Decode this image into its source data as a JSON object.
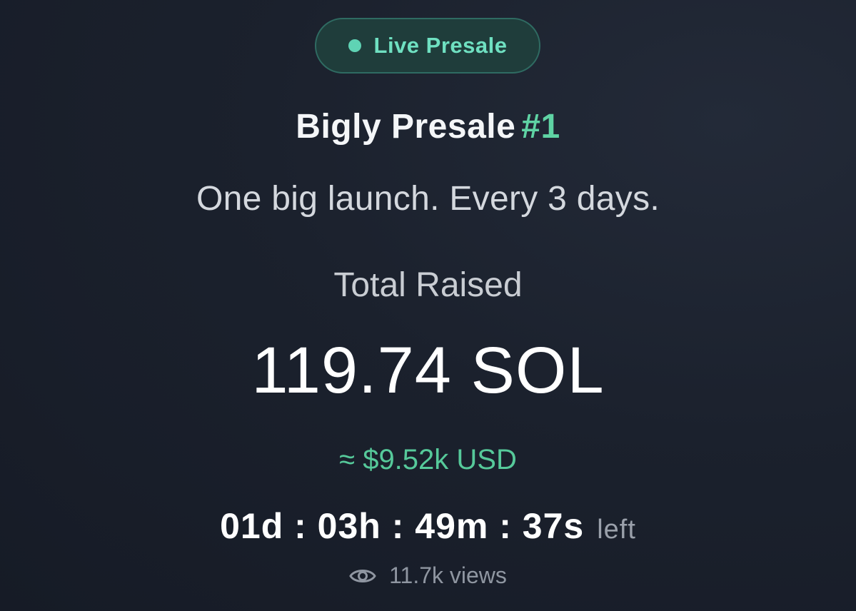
{
  "badge": {
    "label": "Live Presale",
    "dot_color": "#5fd3b4"
  },
  "presale": {
    "title": "Bigly Presale",
    "number": "#1",
    "tagline": "One big launch. Every 3 days."
  },
  "raised": {
    "label": "Total Raised",
    "value": "119.74 SOL",
    "usd": "≈ $9.52k USD"
  },
  "countdown": {
    "time": "01d : 03h : 49m : 37s",
    "suffix": "left"
  },
  "views": {
    "icon": "eye-icon",
    "label": "11.7k views"
  },
  "colors": {
    "accent": "#5fd3a4",
    "background": "#1b212d"
  }
}
